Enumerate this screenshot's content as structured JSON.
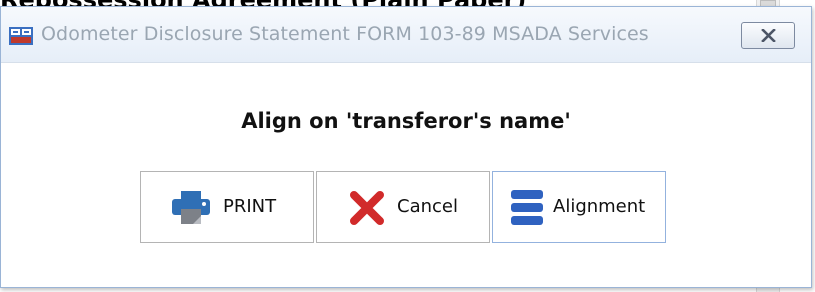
{
  "background_document": {
    "heading_fragment": "Repossession Agreement (Plain Paper)"
  },
  "dialog": {
    "title": "Odometer Disclosure Statement FORM 103-89 MSADA Services",
    "app_icon": "form-app-icon",
    "close_icon": "close-x-icon",
    "prompt": "Align on 'transferor's name'",
    "buttons": {
      "print": {
        "label": "PRINT",
        "icon": "printer-icon",
        "icon_color": "#2f6fb5"
      },
      "cancel": {
        "label": "Cancel",
        "icon": "red-x-icon",
        "icon_color": "#d12a2a"
      },
      "alignment": {
        "label": "Alignment",
        "icon": "stacked-bars-icon",
        "icon_color": "#2f62c0"
      }
    }
  },
  "colors": {
    "title_text": "#9aa6b2",
    "dialog_border": "#9ab4d6",
    "focused_button_border": "#93b2de"
  }
}
